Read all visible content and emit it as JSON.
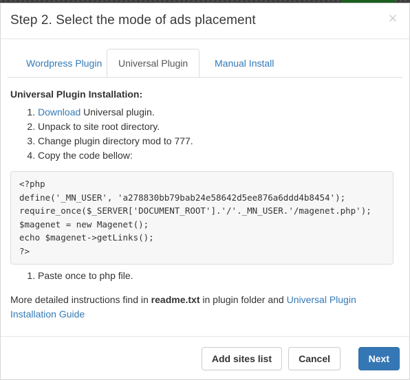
{
  "modal": {
    "title": "Step 2. Select the mode of ads placement",
    "close_label": "×",
    "close_icon": "close-icon"
  },
  "tabs": [
    {
      "label": "Wordpress Plugin",
      "active": false
    },
    {
      "label": "Universal Plugin",
      "active": true
    },
    {
      "label": "Manual Install",
      "active": false
    }
  ],
  "body": {
    "section_title": "Universal Plugin Installation:",
    "steps": [
      {
        "link": "Download",
        "text": " Universal plugin."
      },
      {
        "link": "",
        "text": "Unpack to site root directory."
      },
      {
        "link": "",
        "text": "Change plugin directory mod to 777."
      },
      {
        "link": "",
        "text": "Copy the code bellow:"
      }
    ],
    "code": "<?php\ndefine('_MN_USER', 'a278830bb79bab24e58642d5ee876a6ddd4b8454');\nrequire_once($_SERVER['DOCUMENT_ROOT'].'/'._MN_USER.'/magenet.php');\n$magenet = new Magenet();\necho $magenet->getLinks();\n?>",
    "step_last": "Paste once to php file.",
    "note_prefix": "More detailed instructions find in ",
    "note_bold": "readme.txt",
    "note_middle": " in plugin folder and ",
    "note_link": "Universal Plugin Installation Guide"
  },
  "footer": {
    "add_sites_label": "Add sites list",
    "cancel_label": "Cancel",
    "next_label": "Next"
  },
  "colors": {
    "link": "#337ab7",
    "primary": "#3577b5",
    "code_bg": "#f7f7f7",
    "border": "#dddddd"
  }
}
